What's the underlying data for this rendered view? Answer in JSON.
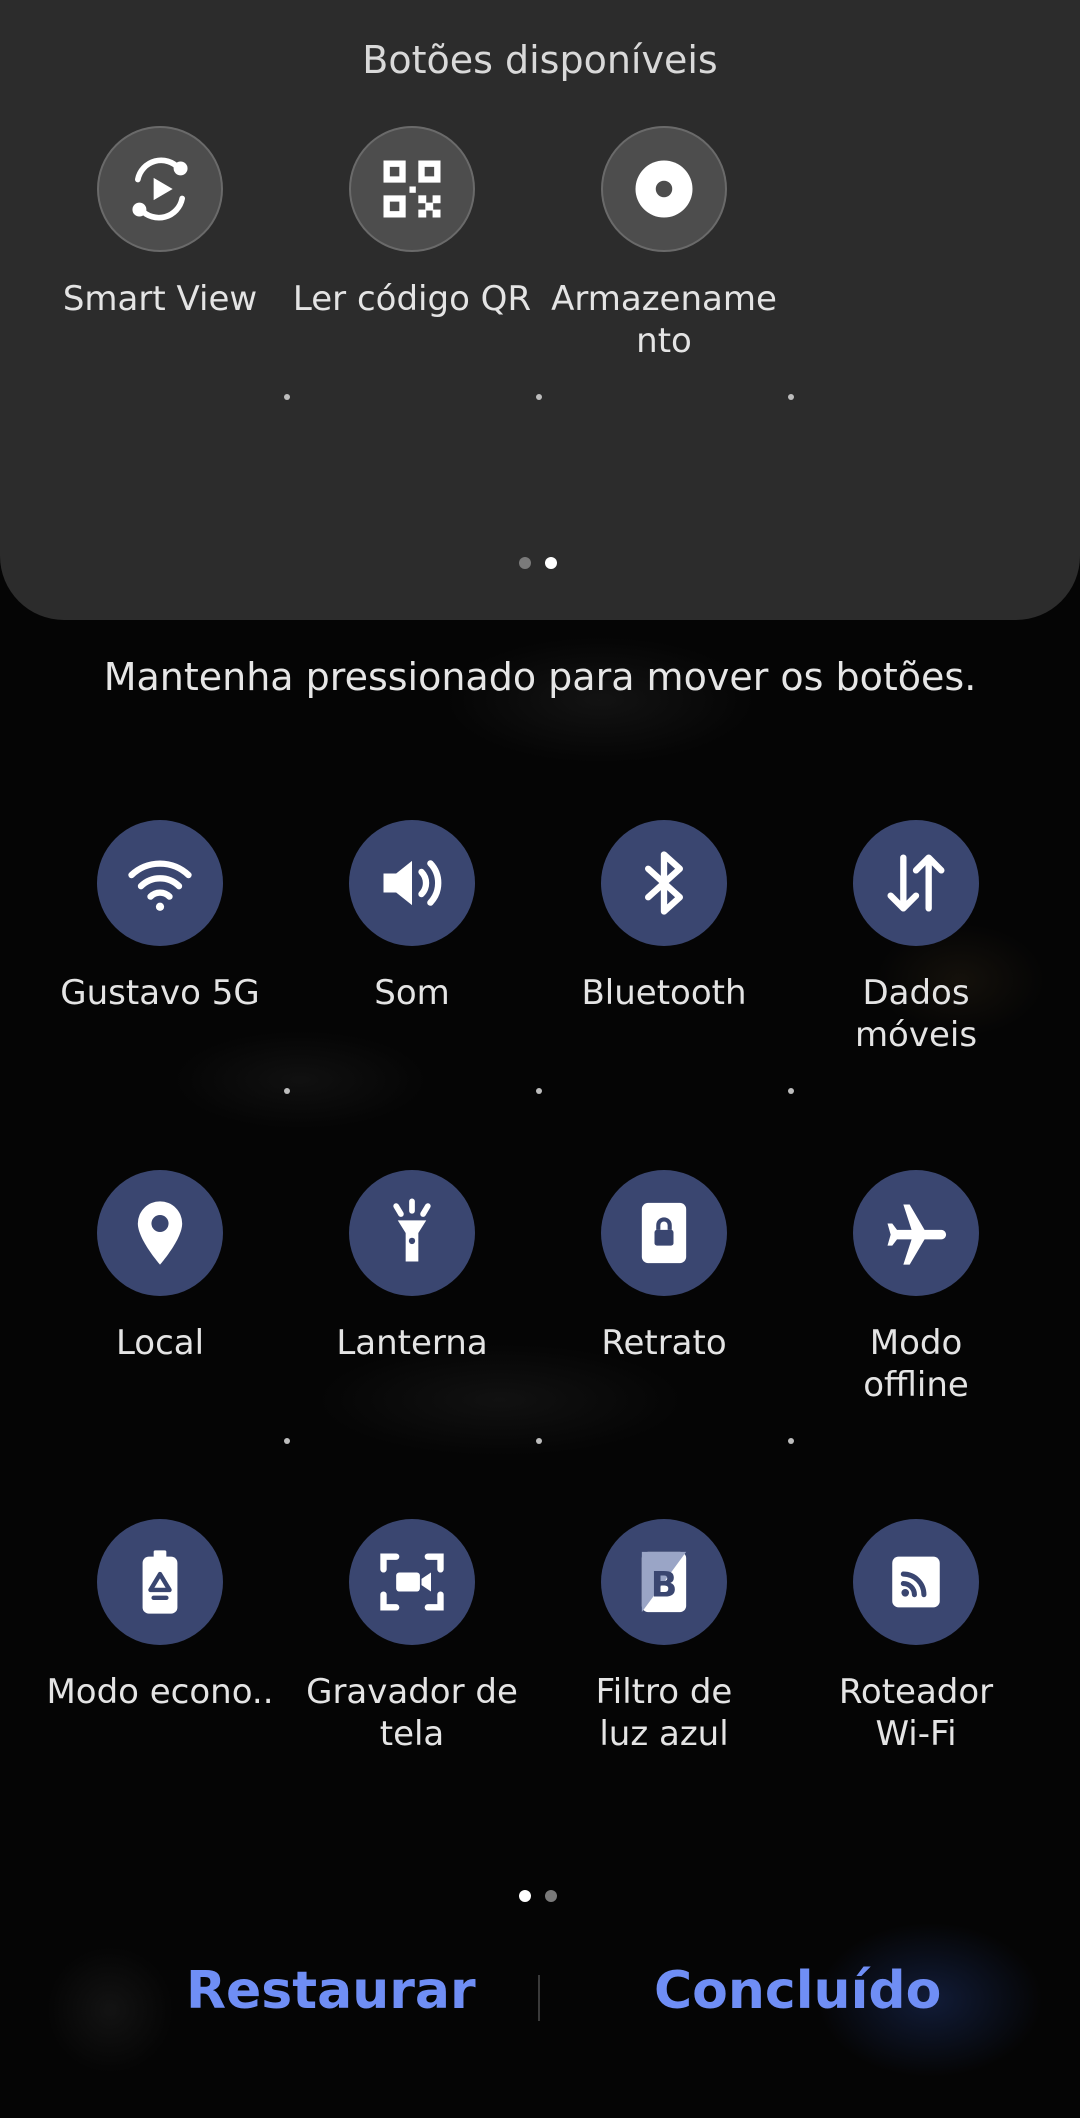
{
  "available": {
    "title": "Botões disponíveis",
    "tiles": [
      {
        "label": "Smart View",
        "icon": "smart-view-icon"
      },
      {
        "label": "Ler código QR",
        "icon": "qr-code-icon"
      },
      {
        "label": "Armazename nto",
        "label_lines": [
          "Armazename",
          "nto"
        ],
        "icon": "storage-icon"
      }
    ],
    "pager_active": 2,
    "pager_total": 2
  },
  "hint": "Mantenha pressionado para mover os botões.",
  "active": {
    "tiles": [
      {
        "label_lines": [
          "Gustavo 5G"
        ],
        "icon": "wifi-icon"
      },
      {
        "label_lines": [
          "Som"
        ],
        "icon": "sound-icon"
      },
      {
        "label_lines": [
          "Bluetooth"
        ],
        "icon": "bluetooth-icon"
      },
      {
        "label_lines": [
          "Dados",
          "móveis"
        ],
        "icon": "mobile-data-icon"
      },
      {
        "label_lines": [
          "Local"
        ],
        "icon": "location-icon"
      },
      {
        "label_lines": [
          "Lanterna"
        ],
        "icon": "flashlight-icon"
      },
      {
        "label_lines": [
          "Retrato"
        ],
        "icon": "portrait-lock-icon"
      },
      {
        "label_lines": [
          "Modo",
          "offline"
        ],
        "icon": "airplane-icon"
      },
      {
        "label_lines": [
          "Modo econo.."
        ],
        "icon": "power-saving-icon"
      },
      {
        "label_lines": [
          "Gravador de",
          "tela"
        ],
        "icon": "screen-recorder-icon"
      },
      {
        "label_lines": [
          "Filtro de",
          "luz azul"
        ],
        "icon": "blue-light-filter-icon"
      },
      {
        "label_lines": [
          "Roteador",
          "Wi-Fi"
        ],
        "icon": "wifi-hotspot-icon"
      }
    ],
    "pager_active": 1,
    "pager_total": 2
  },
  "footer": {
    "reset_label": "Restaurar",
    "done_label": "Concluído"
  },
  "colors": {
    "panel": "#2c2c2c",
    "tile_active": "#3a4670",
    "tile_available": "#4d4d4d",
    "accent": "#6f8ef5"
  }
}
